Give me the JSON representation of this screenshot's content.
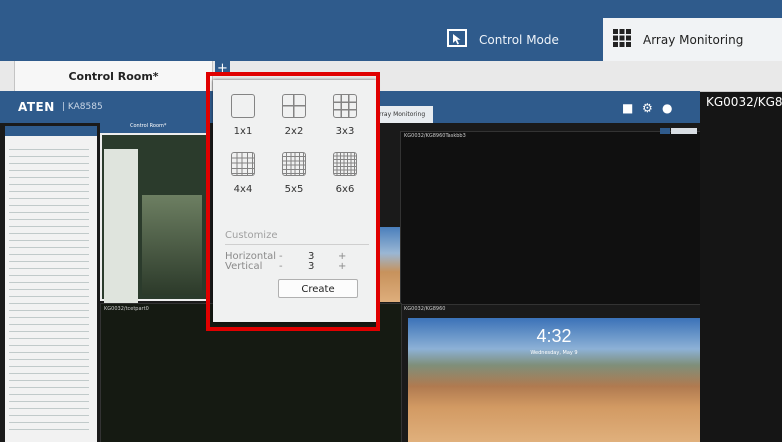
{
  "header": {
    "tabs": [
      {
        "label": "Control Mode",
        "icon": "control-mode-icon"
      },
      {
        "label": "Array Monitoring",
        "icon": "grid-icon"
      }
    ]
  },
  "room_tab": {
    "label": "Control Room*",
    "add_label": "+"
  },
  "inner": {
    "logo": "ATEN",
    "model": "| KA8585",
    "tab_label": "Array Monitoring",
    "pane_labels": [
      "KG0032/KG8960Taskbb3",
      "KG0032/tcetpart0",
      "KG0032/KG8960"
    ],
    "nested_title": "Control Room*"
  },
  "device_label": "KG0032/KG8",
  "clock": {
    "time": "4:32",
    "date": "Wednesday, May 9"
  },
  "grid_popup": {
    "options": [
      "1x1",
      "2x2",
      "3x3",
      "4x4",
      "5x5",
      "6x6"
    ],
    "customize": {
      "title": "Customize",
      "horizontal": {
        "label": "Horizontal",
        "minus": "-",
        "value": "3",
        "plus": "+"
      },
      "vertical": {
        "label": "Vertical",
        "minus": "-",
        "value": "3",
        "plus": "+"
      }
    },
    "create_label": "Create"
  },
  "colors": {
    "header_blue": "#2f5b8c",
    "highlight_red": "#e00000",
    "popup_bg": "#f0f1f1"
  }
}
